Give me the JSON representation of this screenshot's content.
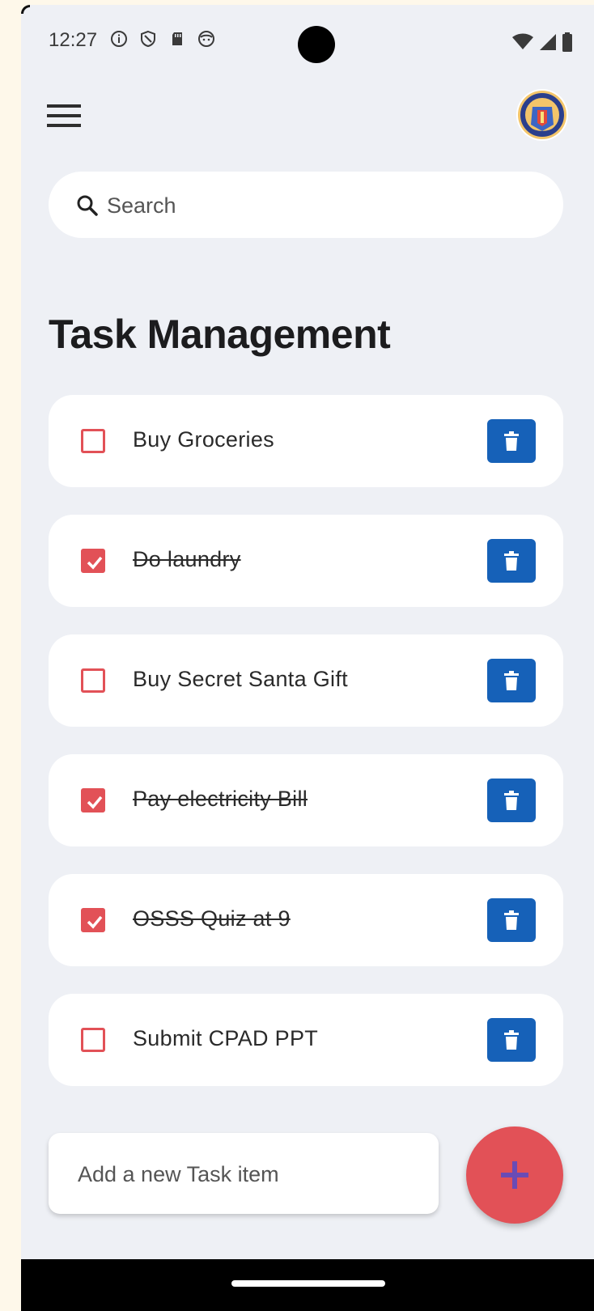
{
  "status_bar": {
    "time": "12:27",
    "icons": [
      "info-icon",
      "shield-icon",
      "sd-card-icon",
      "face-icon"
    ],
    "system_icons": [
      "wifi-icon",
      "signal-icon",
      "battery-icon"
    ]
  },
  "app_bar": {
    "menu_icon": "menu-icon",
    "avatar": "college-emblem"
  },
  "search": {
    "placeholder": "Search"
  },
  "page": {
    "title": "Task Management"
  },
  "tasks": [
    {
      "label": "Buy Groceries",
      "done": false
    },
    {
      "label": "Do laundry",
      "done": true
    },
    {
      "label": "Buy Secret Santa Gift",
      "done": false
    },
    {
      "label": "Pay electricity Bill",
      "done": true
    },
    {
      "label": "OSSS Quiz at 9",
      "done": true
    },
    {
      "label": "Submit CPAD PPT",
      "done": false
    }
  ],
  "new_task": {
    "placeholder": "Add a new Task item"
  },
  "colors": {
    "accent": "#e25157",
    "delete": "#1661b8",
    "background": "#eef0f5",
    "fab_plus": "#6a4bb5"
  }
}
